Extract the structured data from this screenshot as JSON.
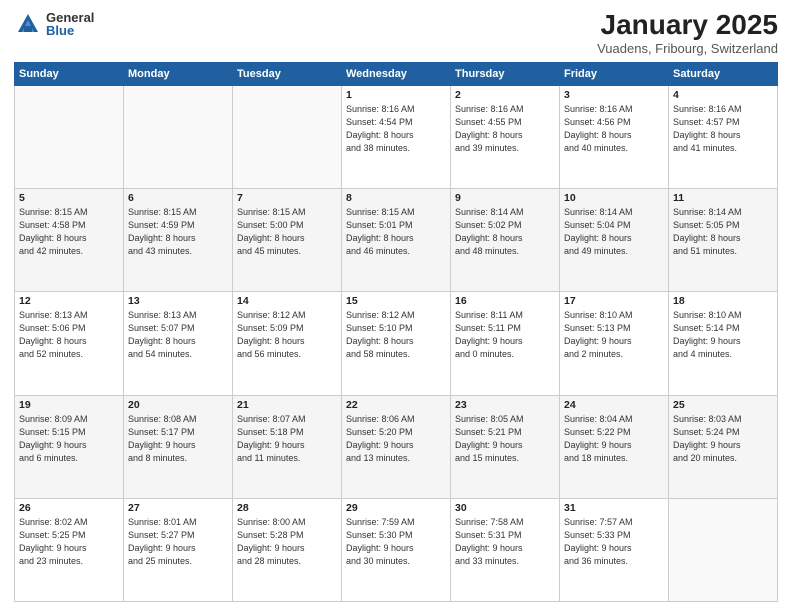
{
  "logo": {
    "general": "General",
    "blue": "Blue"
  },
  "title": {
    "month": "January 2025",
    "location": "Vuadens, Fribourg, Switzerland"
  },
  "days_header": [
    "Sunday",
    "Monday",
    "Tuesday",
    "Wednesday",
    "Thursday",
    "Friday",
    "Saturday"
  ],
  "weeks": [
    [
      {
        "day": "",
        "info": ""
      },
      {
        "day": "",
        "info": ""
      },
      {
        "day": "",
        "info": ""
      },
      {
        "day": "1",
        "info": "Sunrise: 8:16 AM\nSunset: 4:54 PM\nDaylight: 8 hours\nand 38 minutes."
      },
      {
        "day": "2",
        "info": "Sunrise: 8:16 AM\nSunset: 4:55 PM\nDaylight: 8 hours\nand 39 minutes."
      },
      {
        "day": "3",
        "info": "Sunrise: 8:16 AM\nSunset: 4:56 PM\nDaylight: 8 hours\nand 40 minutes."
      },
      {
        "day": "4",
        "info": "Sunrise: 8:16 AM\nSunset: 4:57 PM\nDaylight: 8 hours\nand 41 minutes."
      }
    ],
    [
      {
        "day": "5",
        "info": "Sunrise: 8:15 AM\nSunset: 4:58 PM\nDaylight: 8 hours\nand 42 minutes."
      },
      {
        "day": "6",
        "info": "Sunrise: 8:15 AM\nSunset: 4:59 PM\nDaylight: 8 hours\nand 43 minutes."
      },
      {
        "day": "7",
        "info": "Sunrise: 8:15 AM\nSunset: 5:00 PM\nDaylight: 8 hours\nand 45 minutes."
      },
      {
        "day": "8",
        "info": "Sunrise: 8:15 AM\nSunset: 5:01 PM\nDaylight: 8 hours\nand 46 minutes."
      },
      {
        "day": "9",
        "info": "Sunrise: 8:14 AM\nSunset: 5:02 PM\nDaylight: 8 hours\nand 48 minutes."
      },
      {
        "day": "10",
        "info": "Sunrise: 8:14 AM\nSunset: 5:04 PM\nDaylight: 8 hours\nand 49 minutes."
      },
      {
        "day": "11",
        "info": "Sunrise: 8:14 AM\nSunset: 5:05 PM\nDaylight: 8 hours\nand 51 minutes."
      }
    ],
    [
      {
        "day": "12",
        "info": "Sunrise: 8:13 AM\nSunset: 5:06 PM\nDaylight: 8 hours\nand 52 minutes."
      },
      {
        "day": "13",
        "info": "Sunrise: 8:13 AM\nSunset: 5:07 PM\nDaylight: 8 hours\nand 54 minutes."
      },
      {
        "day": "14",
        "info": "Sunrise: 8:12 AM\nSunset: 5:09 PM\nDaylight: 8 hours\nand 56 minutes."
      },
      {
        "day": "15",
        "info": "Sunrise: 8:12 AM\nSunset: 5:10 PM\nDaylight: 8 hours\nand 58 minutes."
      },
      {
        "day": "16",
        "info": "Sunrise: 8:11 AM\nSunset: 5:11 PM\nDaylight: 9 hours\nand 0 minutes."
      },
      {
        "day": "17",
        "info": "Sunrise: 8:10 AM\nSunset: 5:13 PM\nDaylight: 9 hours\nand 2 minutes."
      },
      {
        "day": "18",
        "info": "Sunrise: 8:10 AM\nSunset: 5:14 PM\nDaylight: 9 hours\nand 4 minutes."
      }
    ],
    [
      {
        "day": "19",
        "info": "Sunrise: 8:09 AM\nSunset: 5:15 PM\nDaylight: 9 hours\nand 6 minutes."
      },
      {
        "day": "20",
        "info": "Sunrise: 8:08 AM\nSunset: 5:17 PM\nDaylight: 9 hours\nand 8 minutes."
      },
      {
        "day": "21",
        "info": "Sunrise: 8:07 AM\nSunset: 5:18 PM\nDaylight: 9 hours\nand 11 minutes."
      },
      {
        "day": "22",
        "info": "Sunrise: 8:06 AM\nSunset: 5:20 PM\nDaylight: 9 hours\nand 13 minutes."
      },
      {
        "day": "23",
        "info": "Sunrise: 8:05 AM\nSunset: 5:21 PM\nDaylight: 9 hours\nand 15 minutes."
      },
      {
        "day": "24",
        "info": "Sunrise: 8:04 AM\nSunset: 5:22 PM\nDaylight: 9 hours\nand 18 minutes."
      },
      {
        "day": "25",
        "info": "Sunrise: 8:03 AM\nSunset: 5:24 PM\nDaylight: 9 hours\nand 20 minutes."
      }
    ],
    [
      {
        "day": "26",
        "info": "Sunrise: 8:02 AM\nSunset: 5:25 PM\nDaylight: 9 hours\nand 23 minutes."
      },
      {
        "day": "27",
        "info": "Sunrise: 8:01 AM\nSunset: 5:27 PM\nDaylight: 9 hours\nand 25 minutes."
      },
      {
        "day": "28",
        "info": "Sunrise: 8:00 AM\nSunset: 5:28 PM\nDaylight: 9 hours\nand 28 minutes."
      },
      {
        "day": "29",
        "info": "Sunrise: 7:59 AM\nSunset: 5:30 PM\nDaylight: 9 hours\nand 30 minutes."
      },
      {
        "day": "30",
        "info": "Sunrise: 7:58 AM\nSunset: 5:31 PM\nDaylight: 9 hours\nand 33 minutes."
      },
      {
        "day": "31",
        "info": "Sunrise: 7:57 AM\nSunset: 5:33 PM\nDaylight: 9 hours\nand 36 minutes."
      },
      {
        "day": "",
        "info": ""
      }
    ]
  ]
}
